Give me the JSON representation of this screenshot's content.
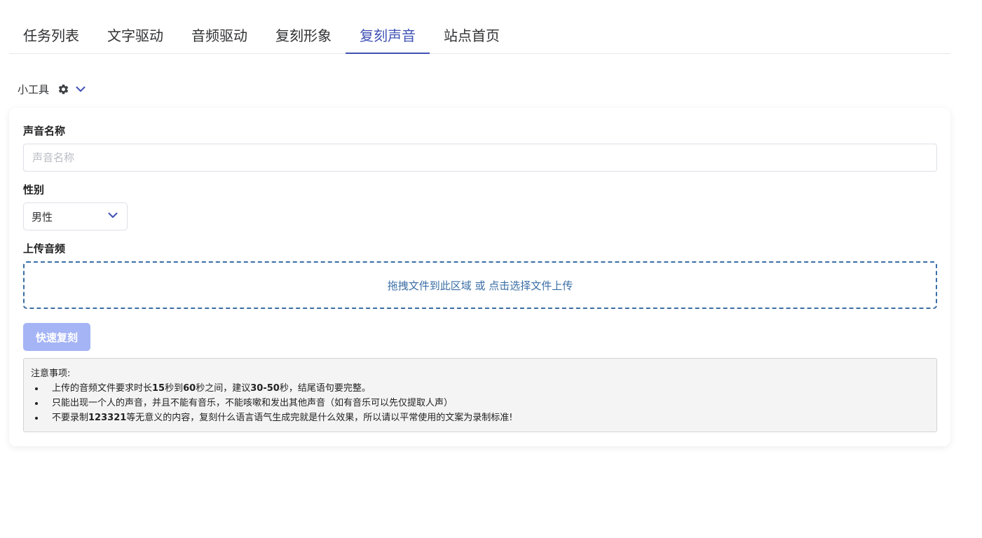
{
  "tabs": [
    {
      "label": "任务列表",
      "active": false
    },
    {
      "label": "文字驱动",
      "active": false
    },
    {
      "label": "音频驱动",
      "active": false
    },
    {
      "label": "复刻形象",
      "active": false
    },
    {
      "label": "复刻声音",
      "active": true
    },
    {
      "label": "站点首页",
      "active": false
    }
  ],
  "tools": {
    "label": "小工具",
    "icon": "gear-icon",
    "dropdown_icon": "chevron-down-icon"
  },
  "form": {
    "voice_name_label": "声音名称",
    "voice_name_value": "",
    "voice_name_placeholder": "声音名称",
    "gender_label": "性别",
    "gender_selected": "男性",
    "upload_label": "上传音频",
    "upload_hint": "拖拽文件到此区域 或 点击选择文件上传",
    "quick_clone_button": "快速复刻"
  },
  "notes": {
    "title": "注意事项:",
    "items": [
      [
        "上传的音频文件要求时长",
        "15",
        "秒到",
        "60",
        "秒之间，建议",
        "30-50",
        "秒，结尾语句要完整。"
      ],
      [
        "只能出现一个人的声音，并且不能有音乐，不能咳嗽和发出其他声音（如有音乐可以先仅提取人声）"
      ],
      [
        "不要录制",
        "123321",
        "等无意义的内容，复刻什么语言语气生成完就是什么效果，所以请以平常使用的文案为录制标准!"
      ]
    ]
  },
  "colors": {
    "accent": "#3f51b5",
    "dropzone": "#3a6ea5",
    "button_disabled": "#a5b4f5"
  }
}
